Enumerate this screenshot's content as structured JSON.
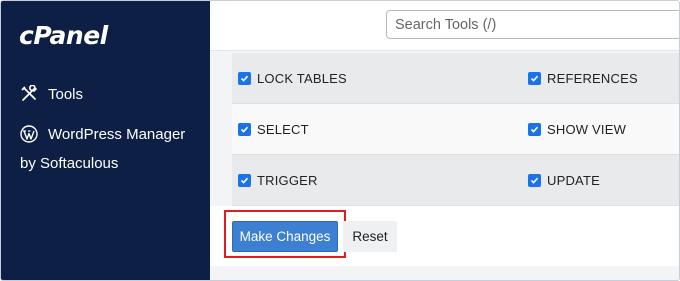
{
  "brand": {
    "logo_text": "cPanel"
  },
  "sidebar": {
    "items": [
      {
        "label": "Tools",
        "icon": "tools-icon"
      },
      {
        "label": "WordPress Manager",
        "icon": "wordpress-icon"
      }
    ],
    "wp_sub_label": "by Softaculous"
  },
  "search": {
    "placeholder": "Search Tools (/)",
    "value": ""
  },
  "privileges": {
    "rows": [
      {
        "left": {
          "label": "LOCK TABLES",
          "checked": true
        },
        "right": {
          "label": "REFERENCES",
          "checked": true
        }
      },
      {
        "left": {
          "label": "SELECT",
          "checked": true
        },
        "right": {
          "label": "SHOW VIEW",
          "checked": true
        }
      },
      {
        "left": {
          "label": "TRIGGER",
          "checked": true
        },
        "right": {
          "label": "UPDATE",
          "checked": true
        }
      }
    ]
  },
  "actions": {
    "make_changes_label": "Make Changes",
    "reset_label": "Reset"
  },
  "colors": {
    "sidebar_bg": "#0d1f44",
    "primary_button": "#3d7fd0",
    "checkbox": "#1a73e8",
    "highlight_border": "#e01b24"
  }
}
